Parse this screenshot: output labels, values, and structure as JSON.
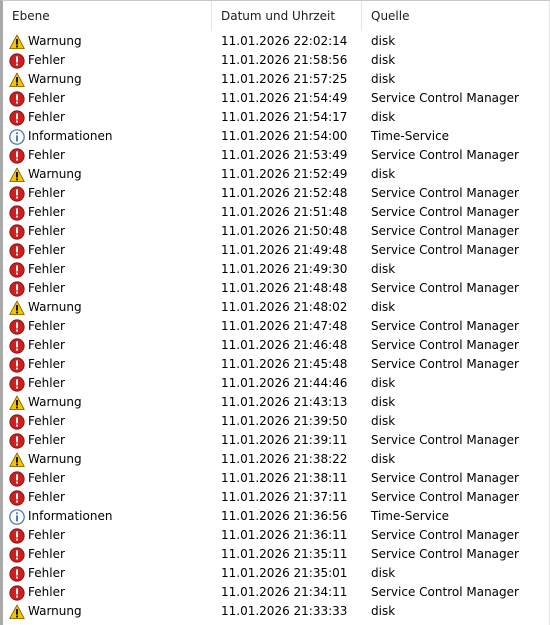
{
  "columns": {
    "level": "Ebene",
    "datetime": "Datum und Uhrzeit",
    "source": "Quelle"
  },
  "level_icons": {
    "Warnung": "warning-icon",
    "Fehler": "error-icon",
    "Informationen": "information-icon"
  },
  "colors": {
    "error": "#cc1f1f",
    "warning": "#f5c400",
    "information": "#3d6fb8"
  },
  "events": [
    {
      "level": "Warnung",
      "datetime": "11.01.2026 22:02:14",
      "source": "disk"
    },
    {
      "level": "Fehler",
      "datetime": "11.01.2026 21:58:56",
      "source": "disk"
    },
    {
      "level": "Warnung",
      "datetime": "11.01.2026 21:57:25",
      "source": "disk"
    },
    {
      "level": "Fehler",
      "datetime": "11.01.2026 21:54:49",
      "source": "Service Control Manager"
    },
    {
      "level": "Fehler",
      "datetime": "11.01.2026 21:54:17",
      "source": "disk"
    },
    {
      "level": "Informationen",
      "datetime": "11.01.2026 21:54:00",
      "source": "Time-Service"
    },
    {
      "level": "Fehler",
      "datetime": "11.01.2026 21:53:49",
      "source": "Service Control Manager"
    },
    {
      "level": "Warnung",
      "datetime": "11.01.2026 21:52:49",
      "source": "disk"
    },
    {
      "level": "Fehler",
      "datetime": "11.01.2026 21:52:48",
      "source": "Service Control Manager"
    },
    {
      "level": "Fehler",
      "datetime": "11.01.2026 21:51:48",
      "source": "Service Control Manager"
    },
    {
      "level": "Fehler",
      "datetime": "11.01.2026 21:50:48",
      "source": "Service Control Manager"
    },
    {
      "level": "Fehler",
      "datetime": "11.01.2026 21:49:48",
      "source": "Service Control Manager"
    },
    {
      "level": "Fehler",
      "datetime": "11.01.2026 21:49:30",
      "source": "disk"
    },
    {
      "level": "Fehler",
      "datetime": "11.01.2026 21:48:48",
      "source": "Service Control Manager"
    },
    {
      "level": "Warnung",
      "datetime": "11.01.2026 21:48:02",
      "source": "disk"
    },
    {
      "level": "Fehler",
      "datetime": "11.01.2026 21:47:48",
      "source": "Service Control Manager"
    },
    {
      "level": "Fehler",
      "datetime": "11.01.2026 21:46:48",
      "source": "Service Control Manager"
    },
    {
      "level": "Fehler",
      "datetime": "11.01.2026 21:45:48",
      "source": "Service Control Manager"
    },
    {
      "level": "Fehler",
      "datetime": "11.01.2026 21:44:46",
      "source": "disk"
    },
    {
      "level": "Warnung",
      "datetime": "11.01.2026 21:43:13",
      "source": "disk"
    },
    {
      "level": "Fehler",
      "datetime": "11.01.2026 21:39:50",
      "source": "disk"
    },
    {
      "level": "Fehler",
      "datetime": "11.01.2026 21:39:11",
      "source": "Service Control Manager"
    },
    {
      "level": "Warnung",
      "datetime": "11.01.2026 21:38:22",
      "source": "disk"
    },
    {
      "level": "Fehler",
      "datetime": "11.01.2026 21:38:11",
      "source": "Service Control Manager"
    },
    {
      "level": "Fehler",
      "datetime": "11.01.2026 21:37:11",
      "source": "Service Control Manager"
    },
    {
      "level": "Informationen",
      "datetime": "11.01.2026 21:36:56",
      "source": "Time-Service"
    },
    {
      "level": "Fehler",
      "datetime": "11.01.2026 21:36:11",
      "source": "Service Control Manager"
    },
    {
      "level": "Fehler",
      "datetime": "11.01.2026 21:35:11",
      "source": "Service Control Manager"
    },
    {
      "level": "Fehler",
      "datetime": "11.01.2026 21:35:01",
      "source": "disk"
    },
    {
      "level": "Fehler",
      "datetime": "11.01.2026 21:34:11",
      "source": "Service Control Manager"
    },
    {
      "level": "Warnung",
      "datetime": "11.01.2026 21:33:33",
      "source": "disk"
    }
  ]
}
